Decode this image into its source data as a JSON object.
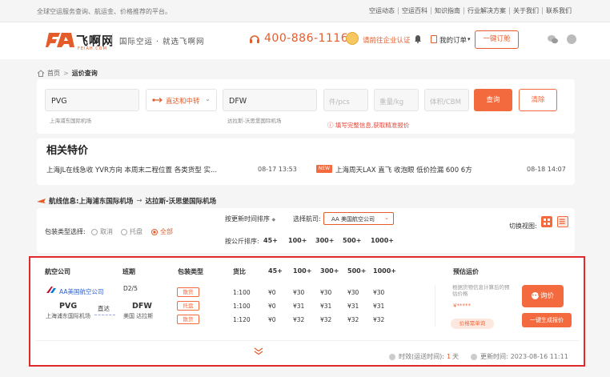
{
  "topbar": {
    "slogan": "全球空运服务查询、航运金、价格推荐的平台。",
    "links": [
      "空运动态",
      "空运百科",
      "知识指南",
      "行业解决方案",
      "关于我们",
      "联系我们"
    ]
  },
  "header": {
    "logo_cn": "飞啊网",
    "logo_en": "FEIAH.COM",
    "tagline": "国际空运 · 就选飞啊网",
    "phone": "400-886-1116",
    "cert_label": "请前往企业认证",
    "order_label": "我的订单",
    "book_button": "一键订舱"
  },
  "breadcrumb": {
    "home": "首页",
    "separator": ">",
    "current": "运价查询"
  },
  "search": {
    "origin_value": "PVG",
    "origin_sub": "上海浦东国际机场",
    "route_type": "直达和中转",
    "dest_value": "DFW",
    "dest_sub": "达拉斯-沃思堡国际机场",
    "pieces_placeholder": "件/pcs",
    "weight_placeholder": "重量/kg",
    "volume_placeholder": "体积/CBM",
    "query_button": "查询",
    "clear_button": "清除",
    "hint": "填写完整信息,获取精准报价"
  },
  "deals": {
    "title": "相关特价",
    "items": [
      {
        "text": "上海JL在线急收 YVR方向 本周末二程位置 各类货型 实...",
        "time": "08-17 13:53",
        "badge": ""
      },
      {
        "text": "上海周天LAX 直飞 收泡眼 低价捡漏 600 6方",
        "time": "08-18 14:07",
        "badge": "NEW"
      }
    ]
  },
  "route_info": {
    "label": "航线信息: ",
    "origin": "上海浦东国际机场",
    "arrow": "→",
    "destination": "达拉斯-沃思堡国际机场"
  },
  "filters": {
    "package_label": "包装类型选择:",
    "package_options": [
      "取消",
      "托盘",
      "全部"
    ],
    "package_selected": "全部",
    "time_sort": "按更新时间排序",
    "airline_label": "选择航司:",
    "airline_value": "AA 美国航空公司",
    "price_sort_label": "按公斤排序:",
    "price_sort_items": [
      "45+",
      "100+",
      "300+",
      "500+",
      "1000+"
    ],
    "view_label": "切换视图:"
  },
  "result": {
    "headers": {
      "airline": "航空公司",
      "schedule": "班期",
      "package": "包装类型",
      "ratio": "货比",
      "w45": "45+",
      "w100": "100+",
      "w300": "300+",
      "w500": "500+",
      "w1000": "1000+",
      "estimate": "预估运价"
    },
    "airline_name": "AA美国航空公司",
    "schedule": "D2/5",
    "origin_code": "PVG",
    "origin_city": "上海浦东国际机场",
    "direct": "直达",
    "dest_code": "DFW",
    "dest_city": "美国 达拉斯",
    "rows": [
      {
        "package": "散货",
        "ratio": "1:100",
        "w45": "¥0",
        "w100": "¥30",
        "w300": "¥30",
        "w500": "¥30",
        "w1000": "¥30"
      },
      {
        "package": "托盘",
        "ratio": "1:100",
        "w45": "¥0",
        "w100": "¥31",
        "w300": "¥31",
        "w500": "¥31",
        "w1000": "¥31"
      },
      {
        "package": "散货",
        "ratio": "1:120",
        "w45": "¥0",
        "w100": "¥32",
        "w300": "¥32",
        "w500": "¥32",
        "w1000": "¥32"
      }
    ],
    "estimate_note": "根据货物信息计算后的预估价格",
    "estimate_stars": "¥*****",
    "trend_button": "价格需单询",
    "ask_button": "询价",
    "generate_button": "一键生成报价",
    "validity_label": "时效(运送时间):",
    "validity_value": "1",
    "validity_unit": "天",
    "updated_label": "更新时间:",
    "updated_value": "2023-08-16 11:11"
  },
  "colors": {
    "accent": "#f26a3d",
    "highlight_border": "#e0292a",
    "link_blue": "#2a5fd1"
  }
}
